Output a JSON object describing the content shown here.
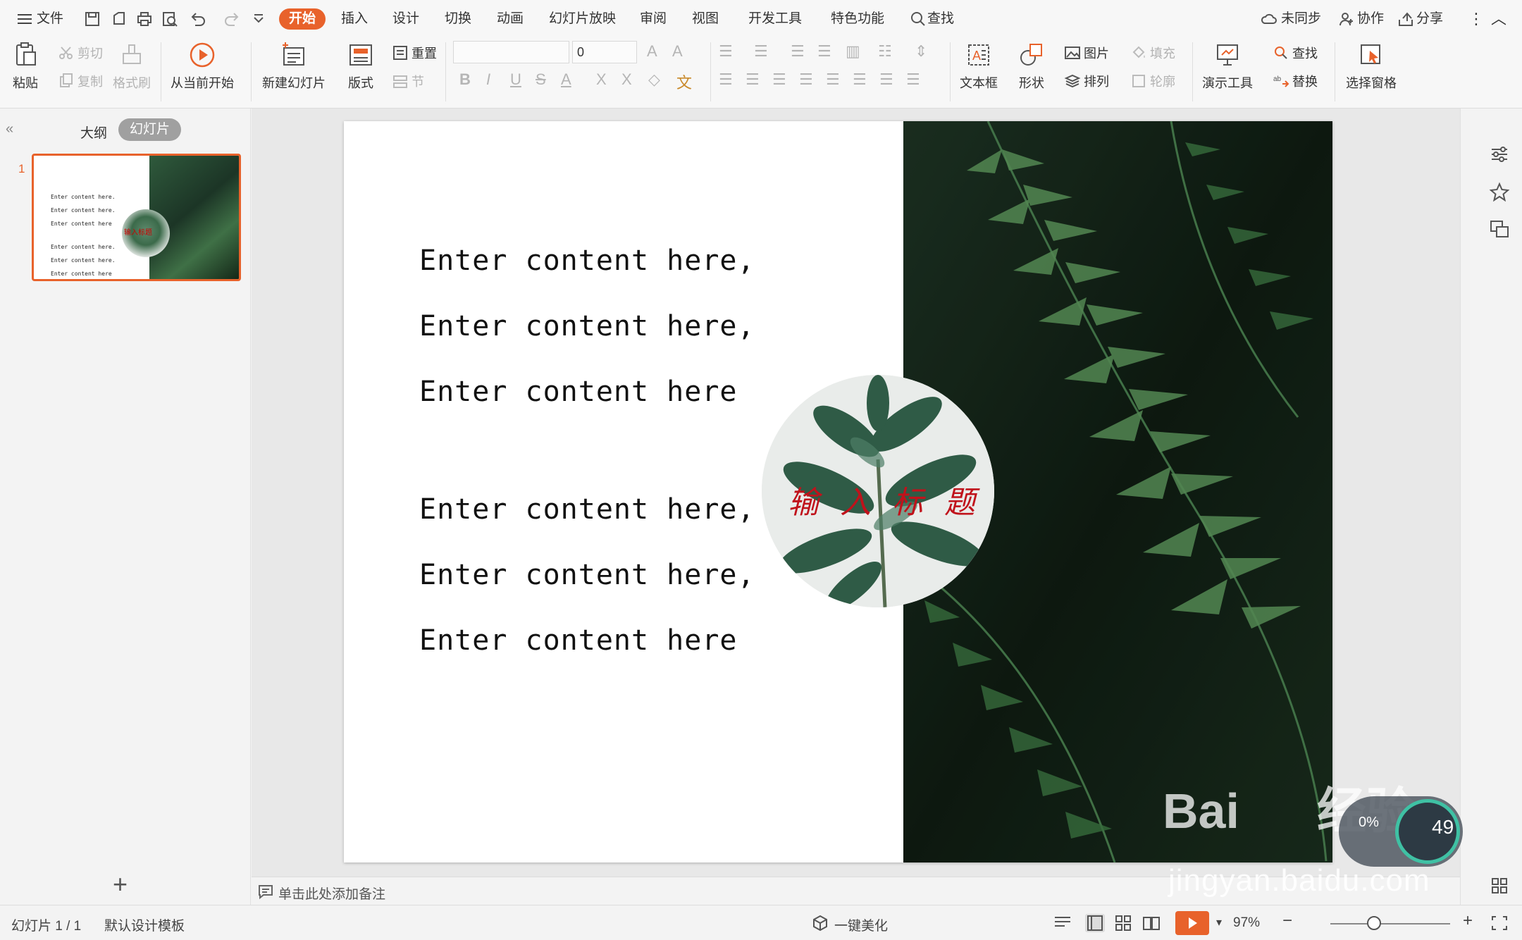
{
  "menubar": {
    "file": "文件",
    "tabs": [
      "开始",
      "插入",
      "设计",
      "切换",
      "动画",
      "幻灯片放映",
      "审阅",
      "视图",
      "开发工具",
      "特色功能"
    ],
    "search": "查找",
    "sync": "未同步",
    "collab": "协作",
    "share": "分享"
  },
  "ribbon": {
    "paste": "粘贴",
    "cut": "剪切",
    "copy": "复制",
    "format_painter": "格式刷",
    "from_current": "从当前开始",
    "new_slide": "新建幻灯片",
    "layout": "版式",
    "reset": "重置",
    "section": "节",
    "font_size": "0",
    "textbox": "文本框",
    "shape": "形状",
    "picture": "图片",
    "fill": "填充",
    "arrange": "排列",
    "outline": "轮廓",
    "present_tool": "演示工具",
    "find": "查找",
    "replace": "替换",
    "select_pane": "选择窗格"
  },
  "leftpanel": {
    "outline_tab": "大纲",
    "slides_tab": "幻灯片",
    "slide_number": "1",
    "thumb_lines": [
      "Enter content here.",
      "Enter content here.",
      "Enter content here",
      "Enter content here.",
      "Enter content here.",
      "Enter content here"
    ],
    "thumb_title": "输入标题"
  },
  "slide": {
    "content_lines": [
      "Enter content here,",
      "Enter content here,",
      "Enter content here",
      "Enter content here,",
      "Enter content here,",
      "Enter content here"
    ],
    "title": "输入标题"
  },
  "notes": {
    "placeholder": "单击此处添加备注"
  },
  "statusbar": {
    "slide_info": "幻灯片 1 / 1",
    "template": "默认设计模板",
    "beautify": "一键美化",
    "zoom": "97%"
  },
  "watermark": {
    "brand": "Bai",
    "brand_cn": "经验",
    "url": "jingyan.baidu.com",
    "gauge_pct": "0%",
    "gauge_val": "49"
  },
  "colors": {
    "accent": "#e8622b",
    "title_red": "#c0121b"
  }
}
